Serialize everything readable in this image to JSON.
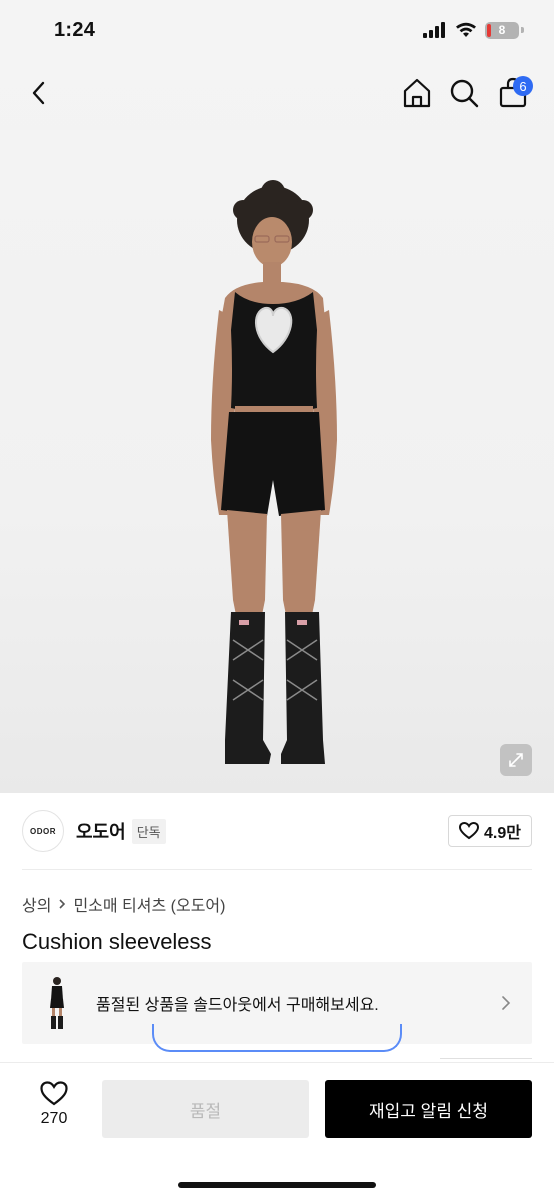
{
  "status_bar": {
    "time": "1:24",
    "battery": "8",
    "icons": [
      "signal-icon",
      "wifi-icon",
      "battery-icon"
    ]
  },
  "nav": {
    "icons": [
      "back-icon",
      "home-icon",
      "search-icon",
      "bag-icon"
    ],
    "cart_count": "6"
  },
  "hero": {
    "icons": [
      "expand-icon"
    ]
  },
  "brand": {
    "logo_text": "ODOR",
    "name": "오도어",
    "tag": "단독",
    "likes": "4.9만"
  },
  "breadcrumb": {
    "category": "상의",
    "subcategory": "민소매 티셔츠 (오도어)"
  },
  "product": {
    "title": "Cushion sleeveless"
  },
  "soldout_banner": {
    "text": "품절된 상품을 솔드아웃에서 구매해보세요."
  },
  "bottom_bar": {
    "like_count": "270",
    "soldout_label": "품절",
    "restock_label": "재입고 알림 신청"
  },
  "colors": {
    "accent": "#2f6bf3",
    "primary_button": "#000000",
    "disabled_button": "#ececec"
  }
}
